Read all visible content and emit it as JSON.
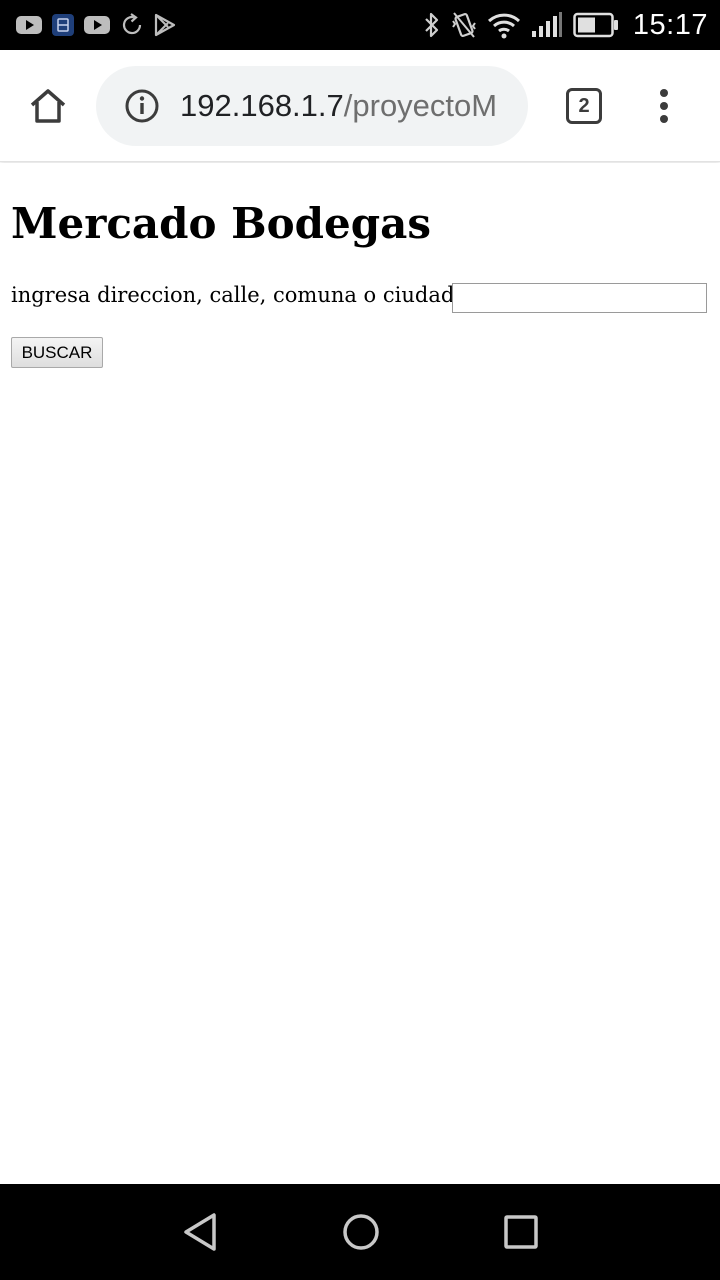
{
  "status_bar": {
    "time": "15:17",
    "left_icons": [
      "youtube-icon",
      "app-notification-icon",
      "youtube-icon",
      "sync-icon",
      "play-store-icon"
    ],
    "right_icons": [
      "bluetooth-icon",
      "vibrate-icon",
      "wifi-icon",
      "signal-icon",
      "battery-icon"
    ]
  },
  "browser": {
    "url_host": "192.168.1.7",
    "url_path": "/proyectoM",
    "tab_count": "2"
  },
  "page": {
    "title": "Mercado Bodegas",
    "search_label": "ingresa direccion, calle, comuna o ciudad",
    "search_value": "",
    "search_button": "BUSCAR"
  },
  "colors": {
    "status_bar_bg": "#000000",
    "toolbar_bg": "#ffffff",
    "omnibox_bg": "#f1f3f4",
    "nav_bar_bg": "#000000"
  }
}
